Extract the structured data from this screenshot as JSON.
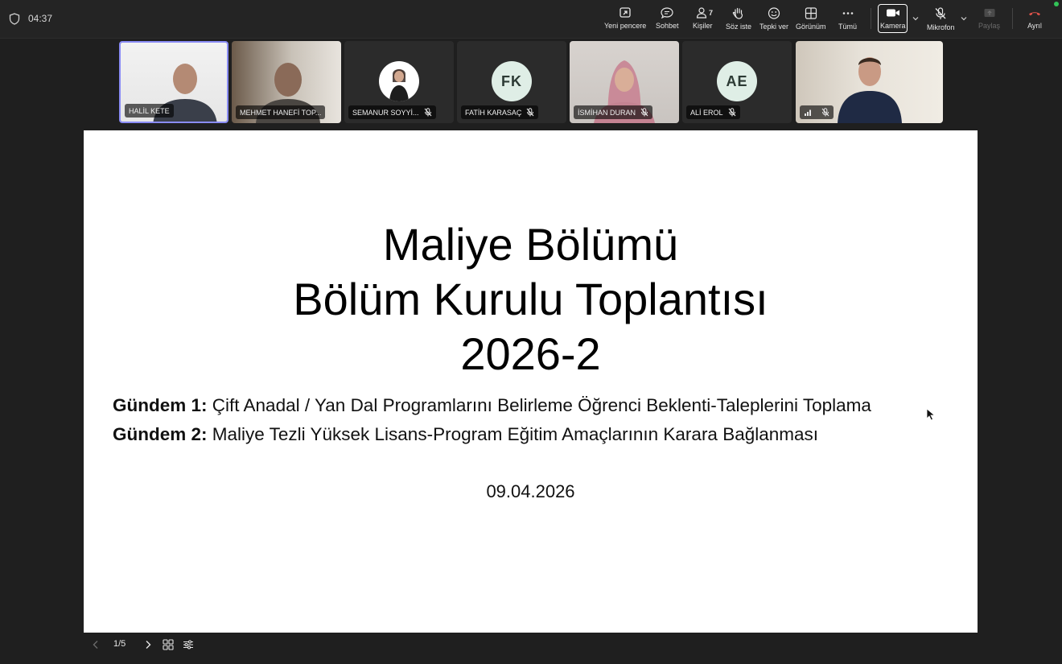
{
  "topbar": {
    "timer": "04:37",
    "buttons": {
      "new_window": "Yeni pencere",
      "chat": "Sohbet",
      "people": "Kişiler",
      "people_count": "7",
      "raise_hand": "Söz iste",
      "react": "Tepki ver",
      "view": "Görünüm",
      "more": "Tümü",
      "camera": "Kamera",
      "mic": "Mikrofon",
      "share": "Paylaş",
      "leave": "Ayrıl"
    },
    "colors": {
      "leave": "#e0524a",
      "status_dot": "#33c458"
    }
  },
  "participants": [
    {
      "name": "HALİL KETE",
      "type": "video",
      "active": true
    },
    {
      "name": "MEHMET HANEFİ TOP...",
      "type": "video"
    },
    {
      "name": "SEMANUR SOYYİ...",
      "type": "photo",
      "muted": true
    },
    {
      "name": "FATİH KARASAÇ",
      "initials": "FK",
      "type": "initials",
      "muted": true,
      "color": "#dfeee6"
    },
    {
      "name": "İSMİHAN DURAN",
      "type": "video",
      "muted": true
    },
    {
      "name": "ALİ EROL",
      "initials": "AE",
      "type": "initials",
      "muted": true,
      "color": "#dfeee6"
    },
    {
      "name": "",
      "type": "video",
      "muted": true,
      "signal": true
    }
  ],
  "slide": {
    "title_lines": [
      "Maliye Bölümü",
      "Bölüm Kurulu Toplantısı",
      "2026-2"
    ],
    "agenda": [
      {
        "label": "Gündem 1:",
        "text": "Çift Anadal / Yan Dal Programlarını Belirleme Öğrenci Beklenti-Taleplerini Toplama"
      },
      {
        "label": "Gündem 2:",
        "text": "Maliye Tezli Yüksek Lisans-Program Eğitim Amaçlarının Karara Bağlanması"
      }
    ],
    "date": "09.04.2026"
  },
  "presentation_controls": {
    "page_indicator": "1/5"
  }
}
